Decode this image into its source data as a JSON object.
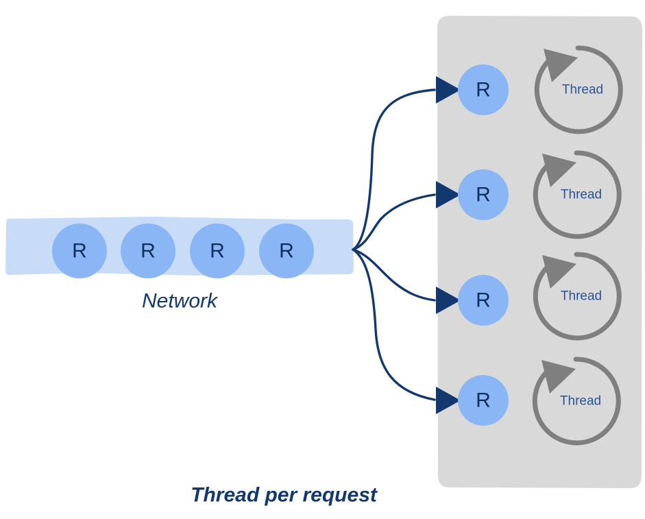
{
  "diagram": {
    "title": "Thread per request",
    "network_label": "Network",
    "colors": {
      "background": "#ffffff",
      "network_bar": "#C8DBF7",
      "request_circle": "#8AB6F5",
      "request_text": "#0F2E5C",
      "arrow": "#13386E",
      "panel": "#D9D9D9",
      "thread_loop": "#7F7F7F",
      "thread_text": "#2B5494",
      "label_text": "#13386E"
    },
    "network": {
      "label": "Network",
      "requests": [
        {
          "label": "R"
        },
        {
          "label": "R"
        },
        {
          "label": "R"
        },
        {
          "label": "R"
        }
      ]
    },
    "server_panel": {
      "rows": [
        {
          "request_label": "R",
          "thread_label": "Thread"
        },
        {
          "request_label": "R",
          "thread_label": "Thread"
        },
        {
          "request_label": "R",
          "thread_label": "Thread"
        },
        {
          "request_label": "R",
          "thread_label": "Thread"
        }
      ]
    },
    "connections": [
      {
        "from": "network-fanout",
        "to": "server-request-1"
      },
      {
        "from": "network-fanout",
        "to": "server-request-2"
      },
      {
        "from": "network-fanout",
        "to": "server-request-3"
      },
      {
        "from": "network-fanout",
        "to": "server-request-4"
      }
    ]
  }
}
